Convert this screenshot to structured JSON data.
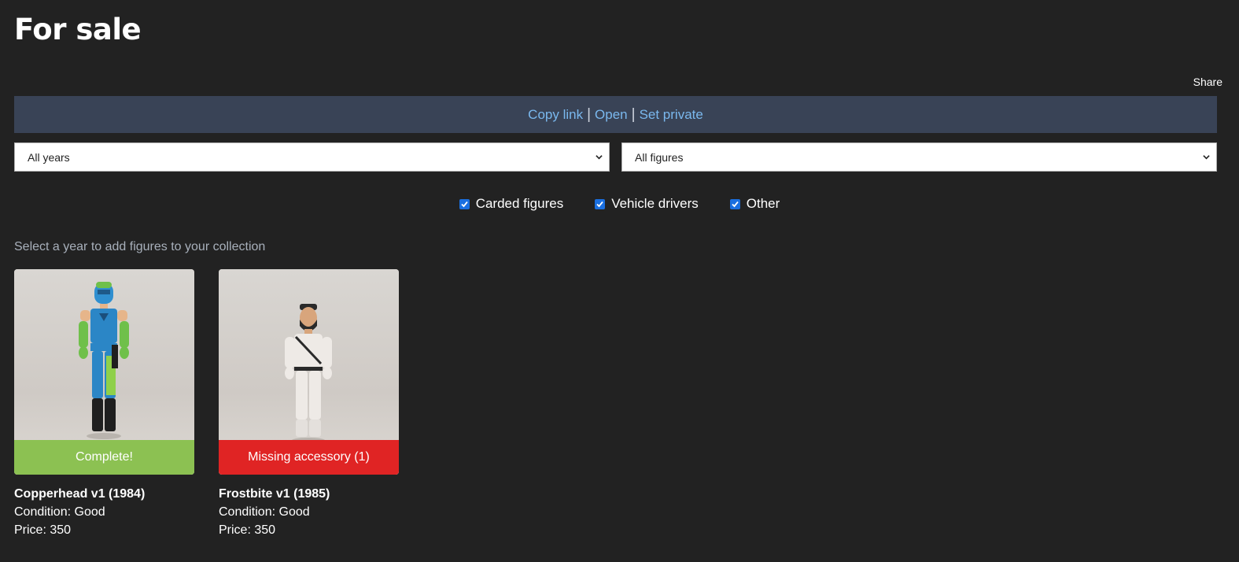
{
  "page": {
    "title": "For sale"
  },
  "share": {
    "label": "Share",
    "copy_link": "Copy link",
    "open": "Open",
    "set_private": "Set private",
    "separator": "|"
  },
  "filters": {
    "years": {
      "selected": "All years"
    },
    "figures": {
      "selected": "All figures"
    },
    "checkboxes": [
      {
        "label": "Carded figures",
        "checked": true
      },
      {
        "label": "Vehicle drivers",
        "checked": true
      },
      {
        "label": "Other",
        "checked": true
      }
    ]
  },
  "hint": "Select a year to add figures to your collection",
  "items": [
    {
      "name": "Copperhead v1 (1984)",
      "status": "Complete!",
      "status_color": "#8cc152",
      "condition": "Condition: Good",
      "price": "Price: 350"
    },
    {
      "name": "Frostbite v1 (1985)",
      "status": "Missing accessory (1)",
      "status_color": "#e02424",
      "condition": "Condition: Good",
      "price": "Price: 350"
    }
  ],
  "colors": {
    "background": "#222222",
    "share_bar": "#394356",
    "link": "#7ab8ee",
    "checkbox": "#1a6fe0"
  }
}
